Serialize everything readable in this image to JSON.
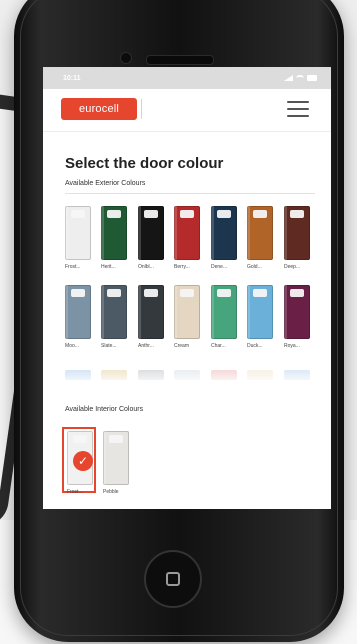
{
  "status_bar": {
    "time": "10:11"
  },
  "header": {
    "logo_text": "eurocell",
    "menu_icon": "hamburger-menu-icon"
  },
  "page": {
    "title": "Select the door colour",
    "exterior_heading": "Available Exterior Colours",
    "interior_heading": "Available Interior Colours"
  },
  "exterior_colours": [
    {
      "label": "Frost...",
      "color": "#eeeeee"
    },
    {
      "label": "Herit...",
      "color": "#1f5a35"
    },
    {
      "label": "Onlbl...",
      "color": "#151515"
    },
    {
      "label": "Berry...",
      "color": "#b52a2a"
    },
    {
      "label": "Dene...",
      "color": "#1d3650"
    },
    {
      "label": "Gold...",
      "color": "#b06428"
    },
    {
      "label": "Deep...",
      "color": "#5e2a22"
    },
    {
      "label": "Moo...",
      "color": "#7c93a6"
    },
    {
      "label": "Slate...",
      "color": "#4c5a66"
    },
    {
      "label": "Anthr...",
      "color": "#33393d"
    },
    {
      "label": "Cream",
      "color": "#e4d6c0"
    },
    {
      "label": "Char...",
      "color": "#47a57e"
    },
    {
      "label": "Duck...",
      "color": "#6ab0d8"
    },
    {
      "label": "Roya...",
      "color": "#6a2046"
    }
  ],
  "partial_row_colours": [
    "#bcd6f2",
    "#e8d9b2",
    "#c7ccd0",
    "#dde4ea",
    "#f2c2c2",
    "#f3e9d6",
    "#c9dcf1"
  ],
  "interior_colours": [
    {
      "label": "Frost...",
      "color": "#f1f1f1",
      "selected": true
    },
    {
      "label": "Pebble",
      "color": "#e7e5e1",
      "selected": false
    }
  ],
  "colors": {
    "accent": "#e6452e"
  }
}
